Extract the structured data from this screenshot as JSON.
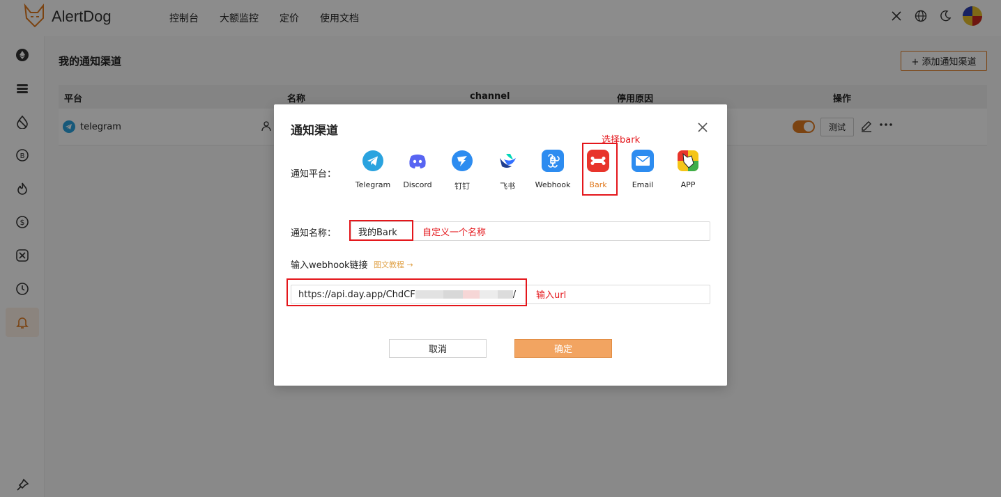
{
  "header": {
    "logo_text": "AlertDog",
    "nav": [
      "控制台",
      "大额监控",
      "定价",
      "使用文档"
    ]
  },
  "page": {
    "title": "我的通知渠道",
    "add_button": "+ 添加通知渠道",
    "table": {
      "headers": [
        "平台",
        "名称",
        "channel",
        "停用原因",
        "操作"
      ],
      "rows": [
        {
          "platform": "telegram",
          "test_label": "测试"
        }
      ]
    }
  },
  "modal": {
    "title": "通知渠道",
    "platform_label": "通知平台：",
    "platforms": [
      "Telegram",
      "Discord",
      "钉钉",
      "飞书",
      "Webhook",
      "Bark",
      "Email",
      "APP"
    ],
    "selected_platform": "Bark",
    "name_label": "通知名称：",
    "name_value": "我的Bark",
    "webhook_label": "输入webhook链接",
    "tutorial_link": "图文教程 →",
    "url_value_prefix": "https://api.day.app/ChdCF",
    "url_value_suffix": "/",
    "cancel_label": "取消",
    "ok_label": "确定"
  },
  "annotations": {
    "select_bark": "选择bark",
    "custom_name": "自定义一个名称",
    "input_url": "输入url"
  },
  "colors": {
    "accent": "#e07a1f",
    "annotation_red": "#e4161b",
    "ok_button": "#f2a461"
  }
}
